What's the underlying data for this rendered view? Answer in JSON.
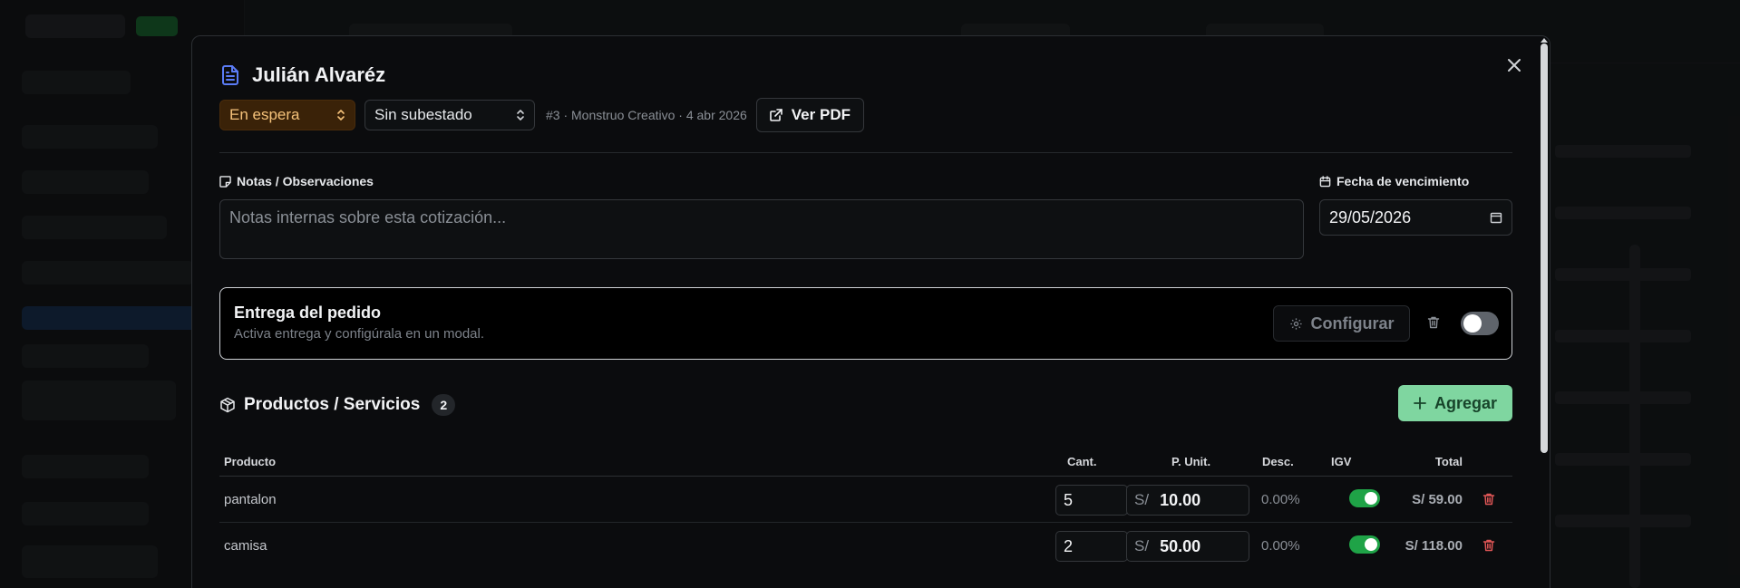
{
  "modal": {
    "title": "Julián Alvaréz",
    "status": "En espera",
    "substatus": "Sin subestado",
    "meta": "#3 · Monstruo Creativo · 4 abr 2026",
    "pdf_label": "Ver PDF"
  },
  "notes": {
    "label": "Notas / Observaciones",
    "placeholder": "Notas internas sobre esta cotización..."
  },
  "due_date": {
    "label": "Fecha de vencimiento",
    "value": "29/05/2026"
  },
  "delivery": {
    "title": "Entrega del pedido",
    "subtitle": "Activa entrega y configúrala en un modal.",
    "config_label": "Configurar",
    "enabled": false
  },
  "products": {
    "title": "Productos / Servicios",
    "count": "2",
    "add_label": "Agregar",
    "columns": {
      "product": "Producto",
      "qty": "Cant.",
      "unit_price": "P. Unit.",
      "discount": "Desc.",
      "igv": "IGV",
      "total": "Total"
    },
    "currency": "S/",
    "rows": [
      {
        "name": "pantalon",
        "qty": "5",
        "unit_price": "10.00",
        "discount": "0.00%",
        "igv": true,
        "total": "S/ 59.00"
      },
      {
        "name": "camisa",
        "qty": "2",
        "unit_price": "50.00",
        "discount": "0.00%",
        "igv": true,
        "total": "S/ 118.00"
      }
    ]
  },
  "colors": {
    "accent_blue": "#5b7cf6",
    "status_bg": "#3a2208",
    "status_text": "#f5c27a",
    "add_button": "#7fd6a0",
    "igv_on": "#1fa347",
    "trash_red": "#e05656"
  }
}
